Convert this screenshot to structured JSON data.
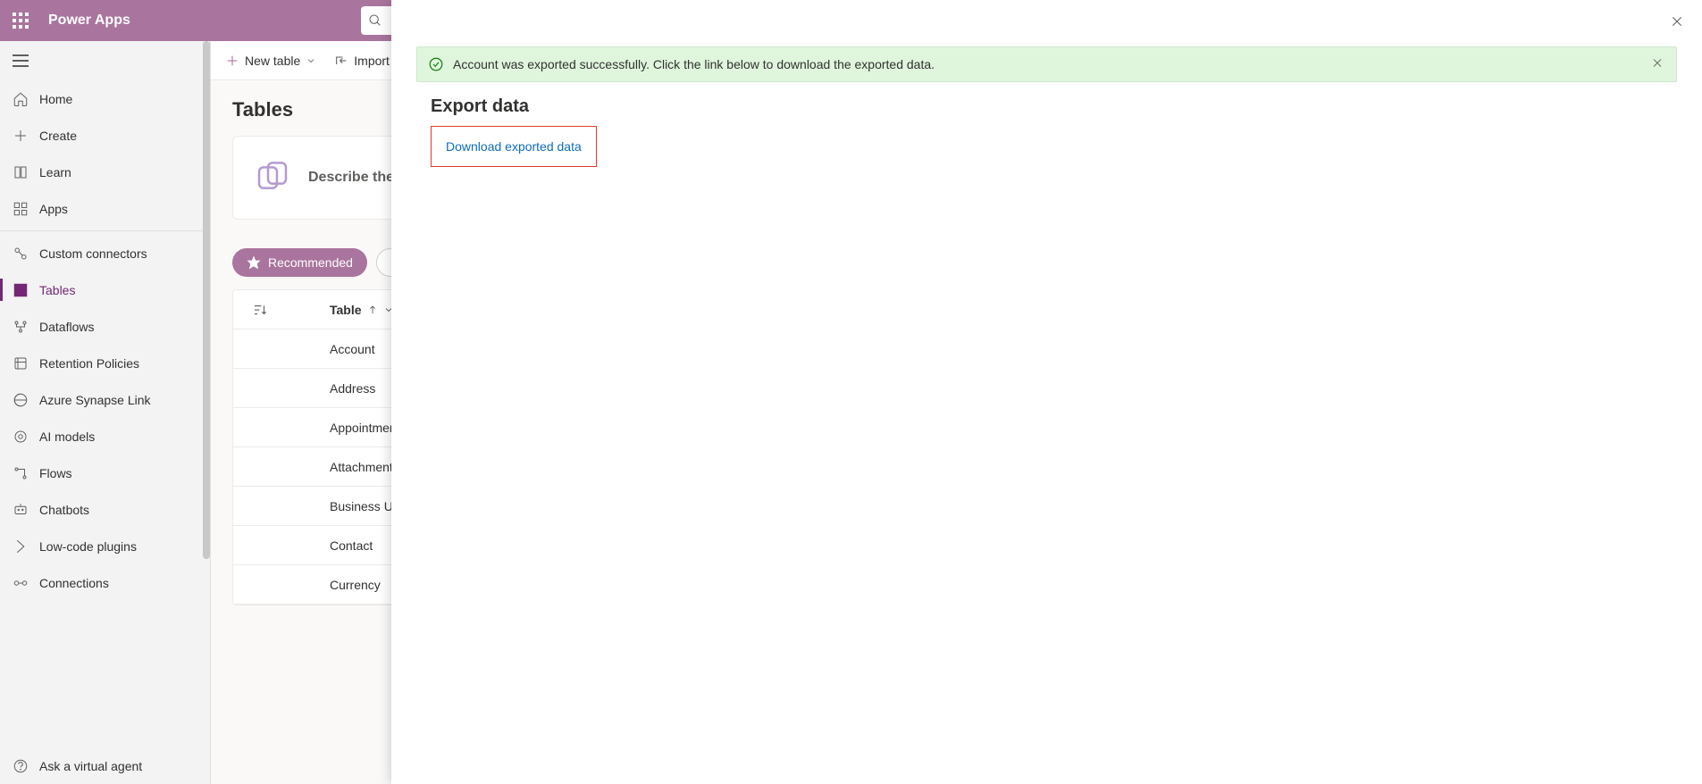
{
  "header": {
    "brand": "Power Apps"
  },
  "nav": {
    "items": [
      {
        "label": "Home"
      },
      {
        "label": "Create"
      },
      {
        "label": "Learn"
      },
      {
        "label": "Apps"
      },
      {
        "label": "Custom connectors"
      },
      {
        "label": "Tables"
      },
      {
        "label": "Dataflows"
      },
      {
        "label": "Retention Policies"
      },
      {
        "label": "Azure Synapse Link"
      },
      {
        "label": "AI models"
      },
      {
        "label": "Flows"
      },
      {
        "label": "Chatbots"
      },
      {
        "label": "Low-code plugins"
      },
      {
        "label": "Connections"
      },
      {
        "label": "Ask a virtual agent"
      }
    ]
  },
  "commands": {
    "new_table": "New table",
    "import": "Import"
  },
  "page": {
    "title": "Tables",
    "copilot_prompt": "Describe the",
    "filter_recommended": "Recommended",
    "col_table": "Table"
  },
  "tables": [
    {
      "name": "Account"
    },
    {
      "name": "Address"
    },
    {
      "name": "Appointment"
    },
    {
      "name": "Attachment"
    },
    {
      "name": "Business Unit"
    },
    {
      "name": "Contact"
    },
    {
      "name": "Currency"
    }
  ],
  "panel": {
    "notice": "Account was exported successfully. Click the link below to download the exported data.",
    "title": "Export data",
    "download_link": "Download exported data"
  }
}
